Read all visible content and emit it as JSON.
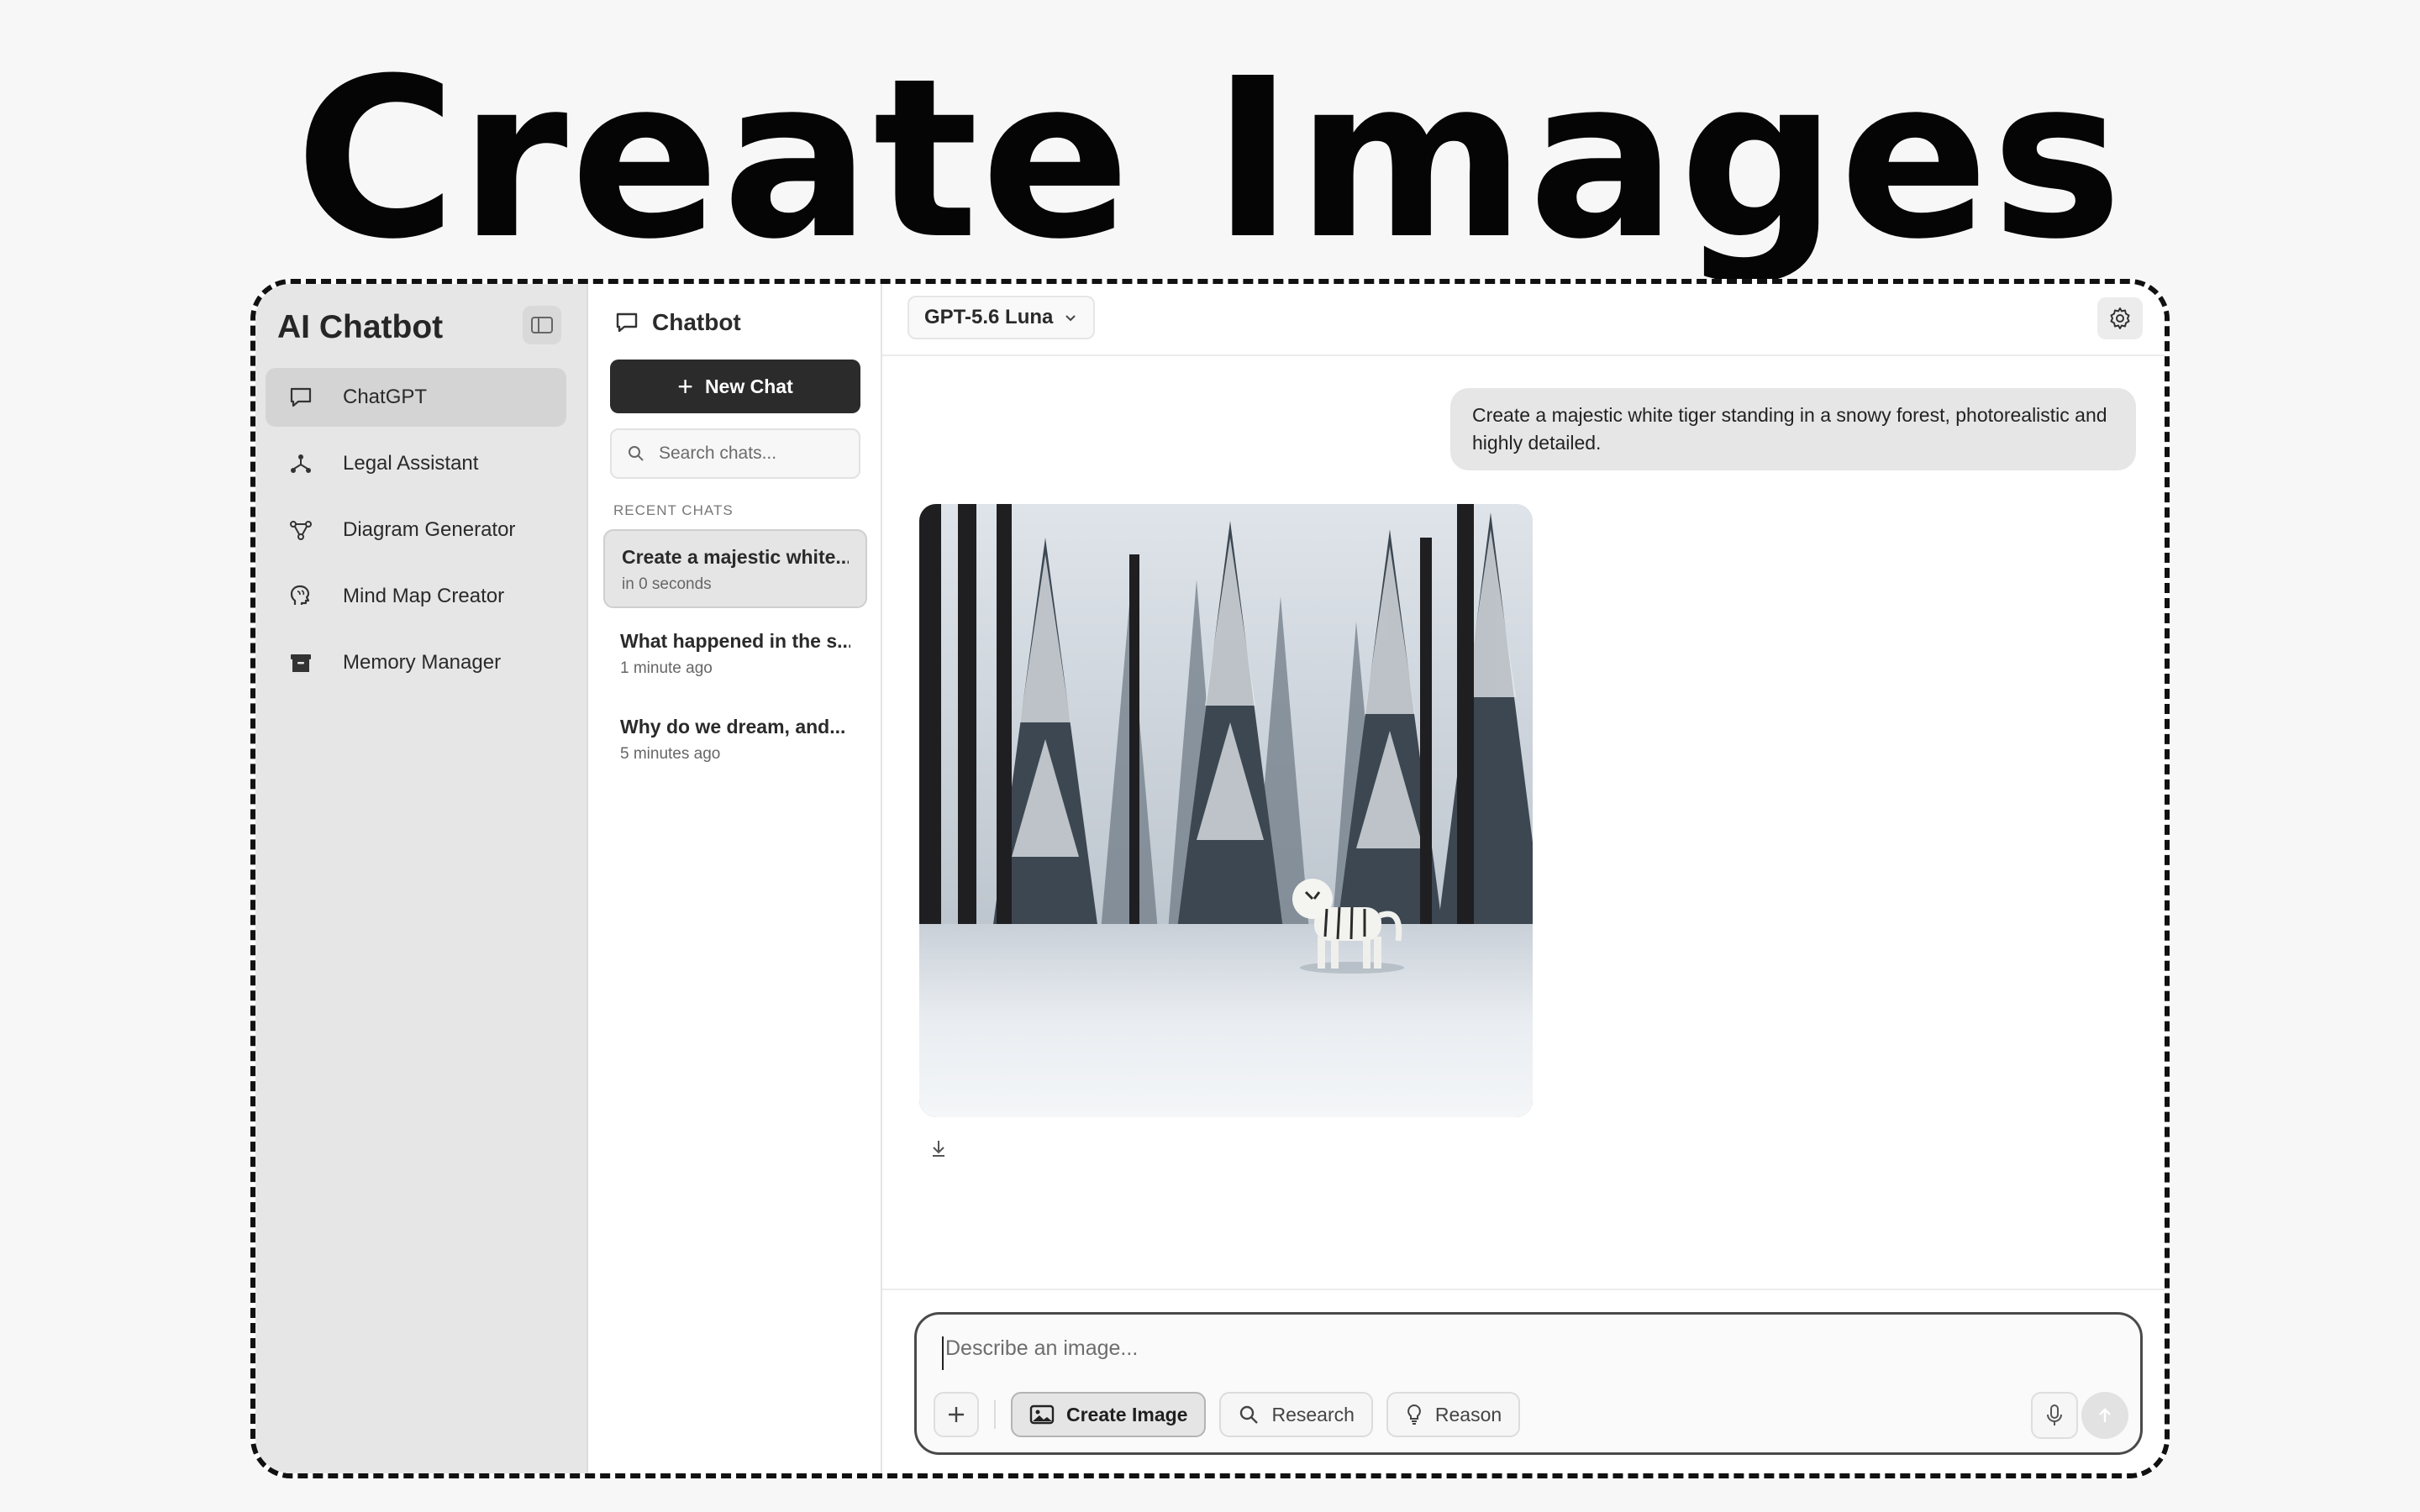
{
  "headline": "Create Images",
  "sidebar": {
    "app_title": "AI Chatbot",
    "items": [
      {
        "label": "ChatGPT",
        "icon": "chat-bubble-icon",
        "active": true
      },
      {
        "label": "Legal Assistant",
        "icon": "network-icon",
        "active": false
      },
      {
        "label": "Diagram Generator",
        "icon": "diagram-icon",
        "active": false
      },
      {
        "label": "Mind Map Creator",
        "icon": "brain-icon",
        "active": false
      },
      {
        "label": "Memory Manager",
        "icon": "archive-icon",
        "active": false
      }
    ]
  },
  "chatlist": {
    "title": "Chatbot",
    "new_chat_label": "New Chat",
    "search_placeholder": "Search chats...",
    "recent_label": "RECENT CHATS",
    "chats": [
      {
        "title": "Create a majestic white...",
        "time": "in 0 seconds",
        "active": true
      },
      {
        "title": "What happened in the s...",
        "time": "1 minute ago",
        "active": false
      },
      {
        "title": "Why do we dream, and...",
        "time": "5 minutes ago",
        "active": false
      }
    ]
  },
  "main": {
    "model": "GPT-5.6 Luna",
    "user_message": "Create a majestic white tiger standing in a snowy forest, photorealistic and highly detailed.",
    "image_subject": "white tiger in snowy forest"
  },
  "composer": {
    "placeholder": "Describe an image...",
    "tools": [
      {
        "label": "Create Image",
        "icon": "image-icon",
        "active": true
      },
      {
        "label": "Research",
        "icon": "search-icon",
        "active": false
      },
      {
        "label": "Reason",
        "icon": "lightbulb-icon",
        "active": false
      }
    ]
  },
  "colors": {
    "sidebar_bg": "#e6e6e6",
    "primary_button": "#2b2b2b",
    "page_bg": "#f7f7f7"
  }
}
